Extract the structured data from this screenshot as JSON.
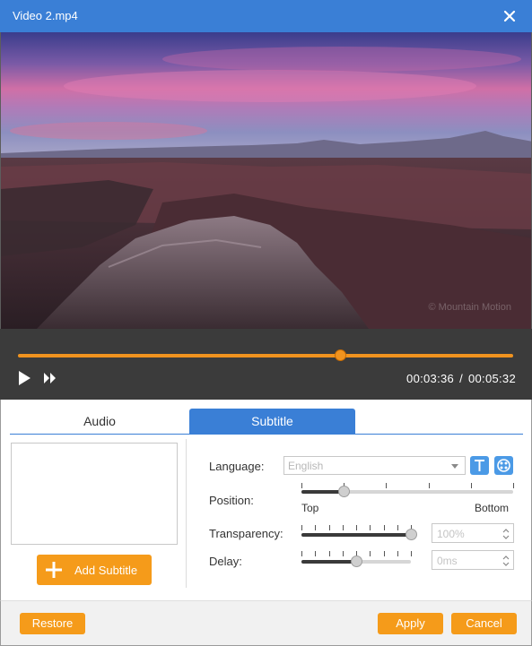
{
  "window": {
    "title": "Video 2.mp4"
  },
  "video": {
    "watermark": "© Mountain Motion"
  },
  "player": {
    "current_time": "00:03:36",
    "separator": "/",
    "total_time": "00:05:32",
    "progress_fraction": 0.65
  },
  "tabs": [
    {
      "label": "Audio",
      "active": false
    },
    {
      "label": "Subtitle",
      "active": true
    }
  ],
  "subtitle_panel": {
    "add_button_label": "Add Subtitle",
    "language_label": "Language:",
    "language_value": "English",
    "position_label": "Position:",
    "position_top_label": "Top",
    "position_bottom_label": "Bottom",
    "position_fraction": 0.2,
    "transparency_label": "Transparency:",
    "transparency_value": "100%",
    "transparency_fraction": 1.0,
    "delay_label": "Delay:",
    "delay_value": "0ms",
    "delay_fraction": 0.5
  },
  "footer": {
    "restore_label": "Restore",
    "apply_label": "Apply",
    "cancel_label": "Cancel"
  },
  "colors": {
    "title_bar": "#3a7fd6",
    "accent_orange": "#f59b1a",
    "control_bar": "#3b3b3b",
    "tab_active": "#3a7fd6"
  },
  "icons": [
    "close-icon",
    "play-icon",
    "fast-forward-icon",
    "plus-icon",
    "font-icon",
    "effect-icon",
    "chevron-down-icon",
    "spin-arrows-icon"
  ]
}
